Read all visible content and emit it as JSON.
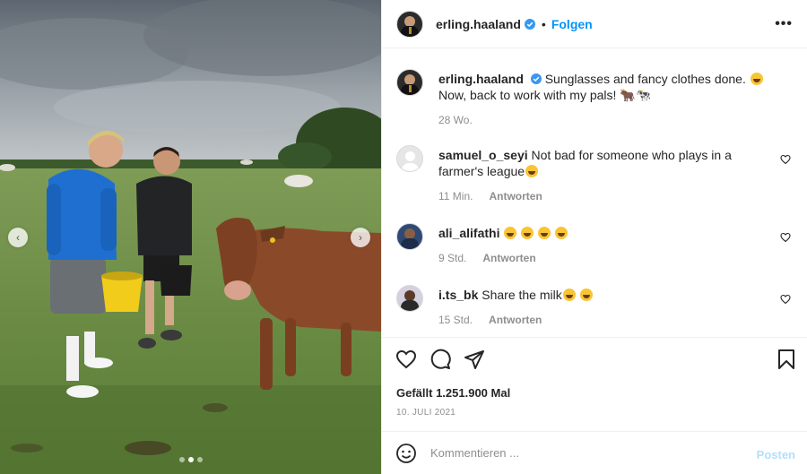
{
  "post": {
    "author": "erling.haaland",
    "follow_label": "Folgen",
    "separator": "•",
    "more_label": "•••",
    "caption_line1": "Sunglasses and fancy clothes done.",
    "caption_line2": "Now, back to work with my pals!",
    "caption_emojis": "🐂🐄",
    "caption_time": "28 Wo."
  },
  "comments": [
    {
      "user": "samuel_o_seyi",
      "text": "Not bad for someone who plays in a farmer's league",
      "time": "11 Min.",
      "reply": "Antworten"
    },
    {
      "user": "ali_alifathi",
      "text": "",
      "time": "9 Std.",
      "reply": "Antworten"
    },
    {
      "user": "i.ts_bk",
      "text": "Share the milk",
      "time": "15 Std.",
      "reply": "Antworten"
    }
  ],
  "likes": "Gefällt 1.251.900 Mal",
  "date": "10. JULI 2021",
  "compose": {
    "placeholder": "Kommentieren ...",
    "post_label": "Posten"
  },
  "media": {
    "prev_label": "‹",
    "next_label": "›",
    "slide_count": 3,
    "active_slide": 2
  },
  "colors": {
    "link_blue": "#0095f6",
    "post_disabled": "#b2dffc",
    "muted_text": "#8e8e8e"
  }
}
